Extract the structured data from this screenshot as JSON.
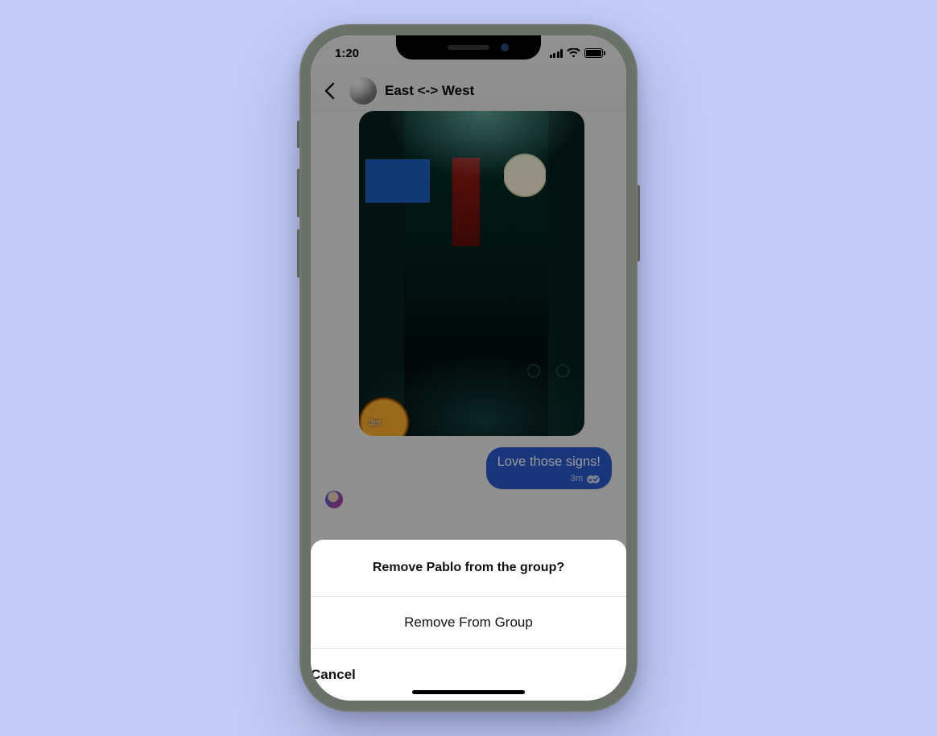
{
  "statusbar": {
    "time": "1:20"
  },
  "header": {
    "group_name": "East <-> West"
  },
  "messages": {
    "received_image": {
      "timestamp": "3m"
    },
    "sent": {
      "text": "Love those signs!",
      "timestamp": "3m"
    }
  },
  "action_sheet": {
    "title": "Remove Pablo from the group?",
    "options": [
      {
        "label": "Remove From Group"
      }
    ],
    "cancel_label": "Cancel"
  }
}
